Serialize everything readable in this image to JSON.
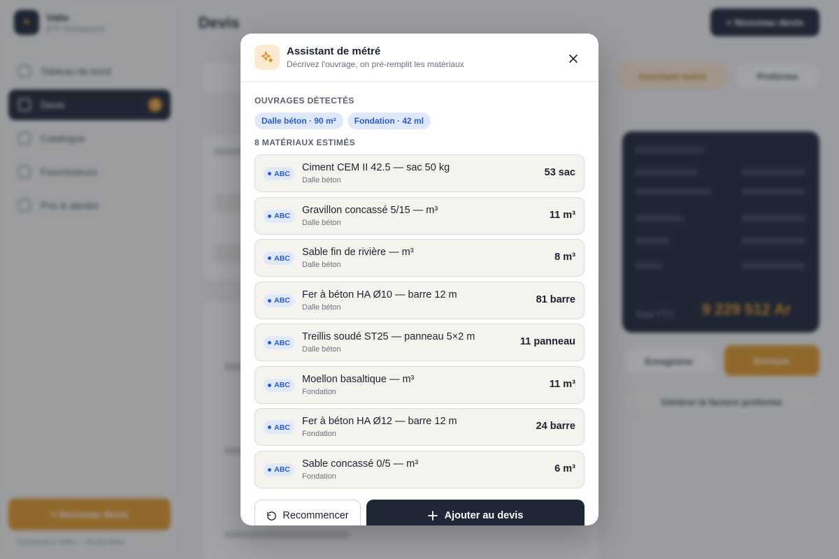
{
  "background": {
    "brand": {
      "name": "Valio",
      "subtitle": "BTP Madagascar"
    },
    "nav": [
      {
        "label": "Tableau de bord",
        "active": false
      },
      {
        "label": "Devis",
        "active": true,
        "badge": "3"
      },
      {
        "label": "Catalogue",
        "active": false
      },
      {
        "label": "Fournisseurs",
        "active": false
      },
      {
        "label": "Prix & alertes",
        "active": false
      }
    ],
    "sidebar_cta": "+ Nouveau devis",
    "sidebar_footer": "Connecté à Valio — Accès beta",
    "page_title": "Devis",
    "top_button": "+ Nouveau devis",
    "assistant_chip": "Assistant métré",
    "proforma_chip": "Proforma",
    "save_button": "Enregistrer",
    "send_button": "Envoyer",
    "proforma_link": "Générer la facture proforma",
    "total_label": "Total TTC",
    "total_value": "9 229 512 Ar"
  },
  "modal": {
    "title": "Assistant de métré",
    "subtitle": "Décrivez l'ouvrage, on pré-remplit les matériaux",
    "detected_label": "OUVRAGES DÉTECTÉS",
    "detected_tags": [
      "Dalle béton · 90 m²",
      "Fondation · 42 ml"
    ],
    "materials_label": "8 MATÉRIAUX ESTIMÉS",
    "abc_label": "ABC",
    "materials": [
      {
        "name": "Ciment CEM II 42.5 — sac 50 kg",
        "group": "Dalle béton",
        "qty": "53 sac"
      },
      {
        "name": "Gravillon concassé 5/15 — m³",
        "group": "Dalle béton",
        "qty": "11 m³"
      },
      {
        "name": "Sable fin de rivière — m³",
        "group": "Dalle béton",
        "qty": "8 m³"
      },
      {
        "name": "Fer à béton HA Ø10 — barre 12 m",
        "group": "Dalle béton",
        "qty": "81 barre"
      },
      {
        "name": "Treillis soudé ST25 — panneau 5×2 m",
        "group": "Dalle béton",
        "qty": "11 panneau"
      },
      {
        "name": "Moellon basaltique — m³",
        "group": "Fondation",
        "qty": "11 m³"
      },
      {
        "name": "Fer à béton HA Ø12 — barre 12 m",
        "group": "Fondation",
        "qty": "24 barre"
      },
      {
        "name": "Sable concassé 0/5 — m³",
        "group": "Fondation",
        "qty": "6 m³"
      }
    ],
    "reset_button": "Recommencer",
    "add_button": "Ajouter au devis"
  },
  "colors": {
    "accent": "#e29a2c",
    "dark": "#1f2736",
    "tag_bg": "#dfe9fb",
    "tag_text": "#2a5bd7"
  }
}
